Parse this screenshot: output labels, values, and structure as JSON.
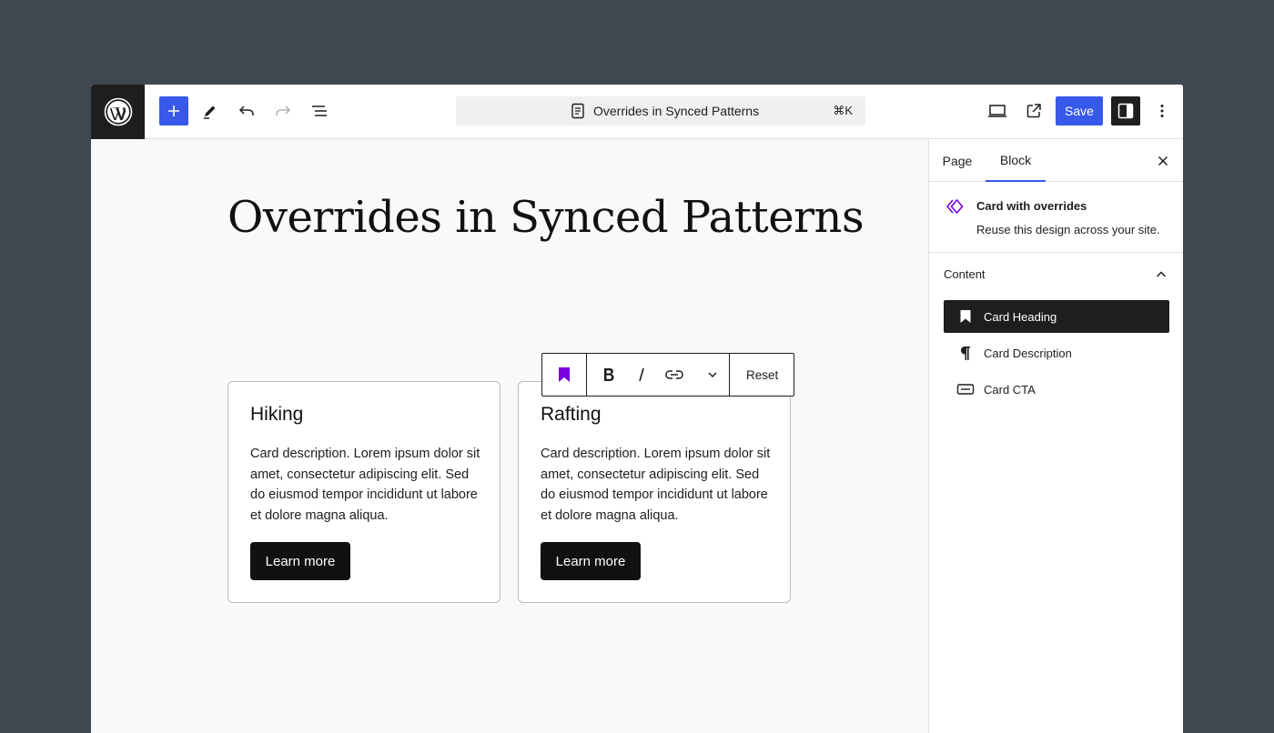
{
  "app": {
    "header": {
      "document_title": "Overrides in Synced Patterns",
      "shortcut": "⌘K",
      "save_label": "Save"
    },
    "canvas": {
      "page_title": "Overrides in Synced Patterns",
      "cards": [
        {
          "heading": "Hiking",
          "description": "Card description. Lorem ipsum dolor sit amet, consectetur adipiscing elit. Sed do eiusmod tempor incididunt ut labore et dolore magna aliqua.",
          "cta": "Learn more"
        },
        {
          "heading": "Rafting",
          "description": "Card description. Lorem ipsum dolor sit amet, consectetur adipiscing elit. Sed do eiusmod tempor incididunt ut labore et dolore magna aliqua.",
          "cta": "Learn more"
        }
      ],
      "block_toolbar": {
        "reset_label": "Reset"
      }
    },
    "sidebar": {
      "tabs": [
        {
          "label": "Page",
          "active": false
        },
        {
          "label": "Block",
          "active": true
        }
      ],
      "block_card": {
        "icon": "synced-pattern-icon",
        "title": "Card with overrides",
        "description": "Reuse this design across your site."
      },
      "content_panel": {
        "label": "Content",
        "expanded": true,
        "items": [
          {
            "label": "Card Heading",
            "icon": "bookmark-icon",
            "active": true
          },
          {
            "label": "Card Description",
            "icon": "paragraph-icon",
            "active": false
          },
          {
            "label": "Card CTA",
            "icon": "button-icon",
            "active": false
          }
        ]
      }
    },
    "colors": {
      "accent": "#3858e9",
      "pattern_purple": "#7a00df",
      "frame_background": "#3f4750",
      "dark": "#1e1e1e"
    }
  }
}
